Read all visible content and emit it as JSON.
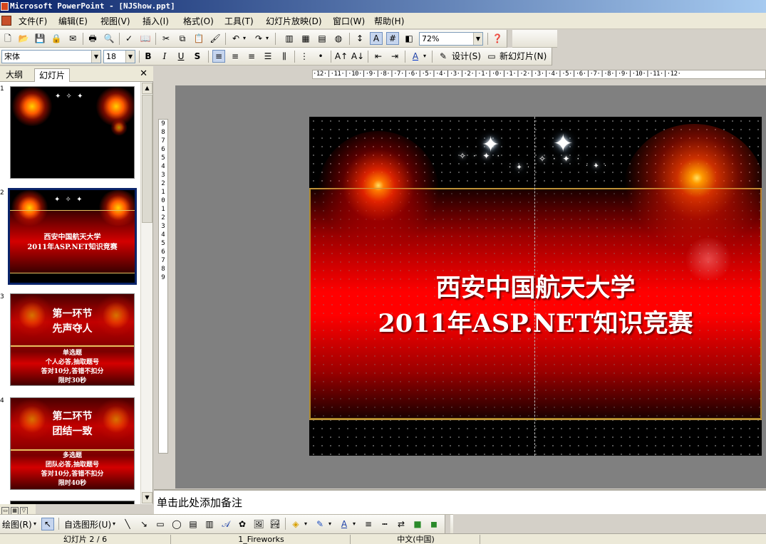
{
  "window": {
    "title": "Microsoft PowerPoint - [NJShow.ppt]"
  },
  "menu": [
    "文件(F)",
    "编辑(E)",
    "视图(V)",
    "插入(I)",
    "格式(O)",
    "工具(T)",
    "幻灯片放映(D)",
    "窗口(W)",
    "帮助(H)"
  ],
  "toolbar1": {
    "zoom": "72%"
  },
  "toolbar2": {
    "font": "宋体",
    "size": "18",
    "design_label": "设计(S)",
    "new_slide_label": "新幻灯片(N)"
  },
  "panel": {
    "tabs": [
      "大纲",
      "幻灯片"
    ],
    "active_tab": "幻灯片"
  },
  "thumbnails": [
    {
      "num": "1",
      "lines": [],
      "body": []
    },
    {
      "num": "2",
      "lines": [
        "西安中国航天大学",
        "2011年ASP.NET知识竞赛"
      ],
      "body": [],
      "selected": true
    },
    {
      "num": "3",
      "lines": [
        "第一环节",
        "先声夺人"
      ],
      "body": [
        "单选题",
        "个人必答,抽取题号",
        "答对10分,答错不扣分",
        "限时30秒"
      ]
    },
    {
      "num": "4",
      "lines": [
        "第二环节",
        "团结一致"
      ],
      "body": [
        "多选题",
        "团队必答,抽取题号",
        "答对10分,答错不扣分",
        "限时40秒"
      ]
    }
  ],
  "rulers": {
    "horizontal": "·12·|·11·|·10·|·9·|·8·|·7·|·6·|·5·|·4·|·3·|·2·|·1·|·0·|·1·|·2·|·3·|·4·|·5·|·6·|·7·|·8·|·9·|·10·|·11·|·12·",
    "vertical": [
      "9",
      "8",
      "7",
      "6",
      "5",
      "4",
      "3",
      "2",
      "1",
      "0",
      "1",
      "2",
      "3",
      "4",
      "5",
      "6",
      "7",
      "8",
      "9"
    ]
  },
  "slide": {
    "title_line1": "西安中国航天大学",
    "title_line2": "2011年ASP.NET知识竞赛"
  },
  "notes": {
    "placeholder": "单击此处添加备注"
  },
  "drawbar": {
    "draw_label": "绘图(R)",
    "autoshape_label": "自选图形(U)"
  },
  "status": {
    "slide": "幻灯片 2 / 6",
    "design": "1_Fireworks",
    "language": "中文(中国)"
  }
}
